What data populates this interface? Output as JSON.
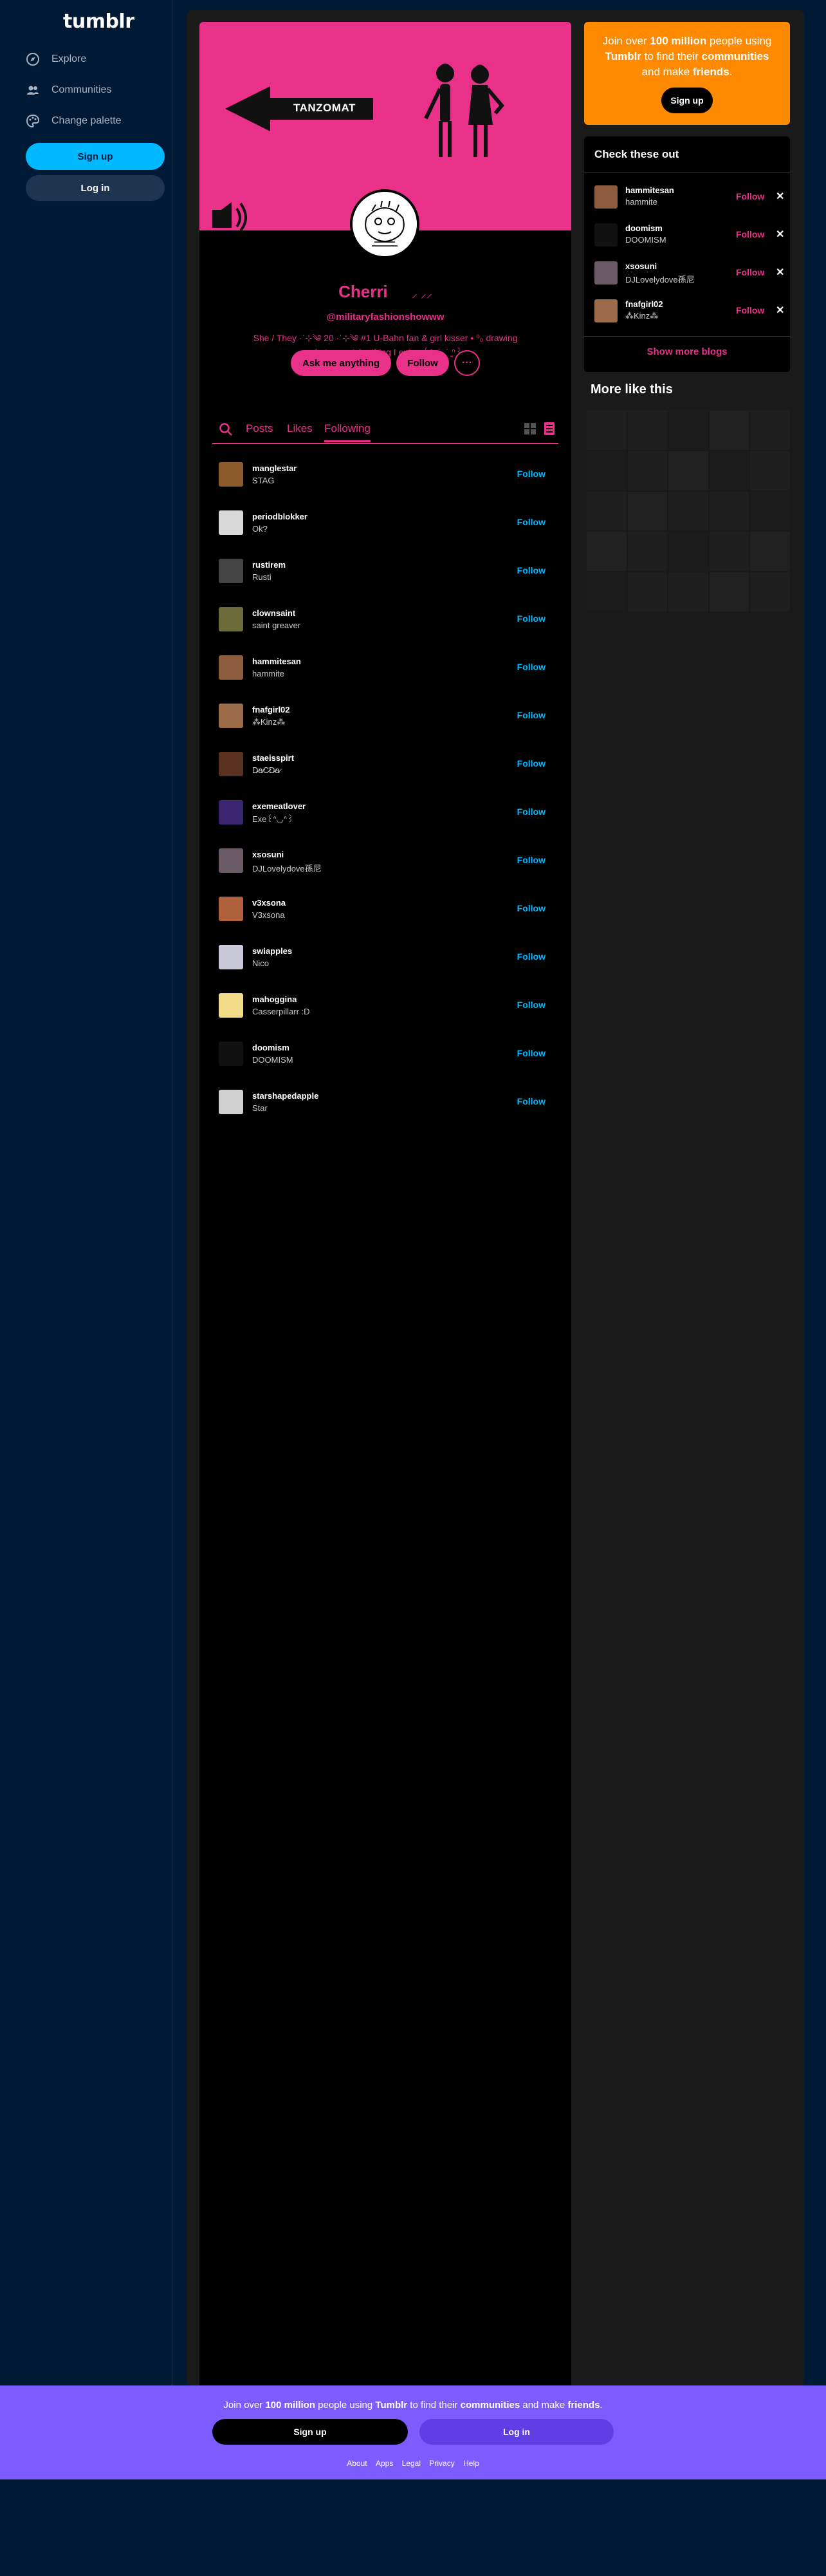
{
  "app": {
    "logo": "tumblr"
  },
  "leftnav": {
    "items": [
      {
        "label": "Explore",
        "icon": "compass-icon"
      },
      {
        "label": "Communities",
        "icon": "people-icon"
      },
      {
        "label": "Change palette",
        "icon": "palette-icon"
      }
    ],
    "signup_label": "Sign up",
    "login_label": "Log in"
  },
  "header": {
    "banner_text": "TANZOMAT",
    "accent": "#e9318a"
  },
  "blog": {
    "title": "Cherri",
    "title_deco": "⸝ ⸝⸝",
    "handle": "@militaryfashionshowww",
    "description": "She / They ·ˈ⊹༄ 20 ·ˈ⊹༄ #1 U-Bahn fan & girl kisser • ⁰₀ drawing whatever niche thing I enjoy ꒰ᐢ ̳ ˙ ̫ ˙ ̳ᐢ꒱",
    "ask_label": "Ask me anything",
    "follow_label": "Follow",
    "more_label": "···"
  },
  "tabs": [
    {
      "label": "Posts",
      "active": false
    },
    {
      "label": "Likes",
      "active": false
    },
    {
      "label": "Following",
      "active": true
    }
  ],
  "following": [
    {
      "name": "manglestar",
      "title": "STAG",
      "follow": "Follow",
      "color": "#8a5a2b"
    },
    {
      "name": "periodblokker",
      "title": "Ok?",
      "follow": "Follow",
      "color": "#d9d9d9"
    },
    {
      "name": "rustirem",
      "title": "Rusti",
      "follow": "Follow",
      "color": "#444444"
    },
    {
      "name": "clownsaint",
      "title": "saint greaver",
      "follow": "Follow",
      "color": "#6b6b3a"
    },
    {
      "name": "hammitesan",
      "title": "hammite",
      "follow": "Follow",
      "color": "#8c5a3c"
    },
    {
      "name": "fnafgirl02",
      "title": "⁂Kinz⁂",
      "follow": "Follow",
      "color": "#9c6b4a"
    },
    {
      "name": "staeisspirt",
      "title": "D̷a̷C̷D̷a̷",
      "follow": "Follow",
      "color": "#5a3020"
    },
    {
      "name": "exemeatlover",
      "title": "Exe꒰ᐢ◡ᐢ꒱",
      "follow": "Follow",
      "color": "#3a2470"
    },
    {
      "name": "xsosuni",
      "title": "DJLovelydove孫尼",
      "follow": "Follow",
      "color": "#6a5a66"
    },
    {
      "name": "v3xsona",
      "title": "V3xsona",
      "follow": "Follow",
      "color": "#b0603a"
    },
    {
      "name": "swiapples",
      "title": "Nico",
      "follow": "Follow",
      "color": "#c8c8d8"
    },
    {
      "name": "mahoggina",
      "title": "Casserpillarr :D",
      "follow": "Follow",
      "color": "#f2dc8a"
    },
    {
      "name": "doomism",
      "title": "DOOMISM",
      "follow": "Follow",
      "color": "#111111"
    },
    {
      "name": "starshapedapple",
      "title": "Star",
      "follow": "Follow",
      "color": "#d0d0d0"
    }
  ],
  "promo": {
    "text_parts": [
      "Join over ",
      "100 million",
      " people using ",
      "Tumblr",
      " to find their ",
      "communities",
      " and make ",
      "friends",
      "."
    ],
    "signup_label": "Sign up",
    "color": "#ff8a00"
  },
  "check": {
    "title": "Check these out",
    "items": [
      {
        "name": "hammitesan",
        "title": "hammite",
        "follow": "Follow",
        "color": "#8c5a3c"
      },
      {
        "name": "doomism",
        "title": "DOOMISM",
        "follow": "Follow",
        "color": "#111111"
      },
      {
        "name": "xsosuni",
        "title": "DJLovelydove孫尼",
        "follow": "Follow",
        "color": "#6a5a66"
      },
      {
        "name": "fnafgirl02",
        "title": "⁂Kinz⁂",
        "follow": "Follow",
        "color": "#9c6b4a"
      }
    ],
    "show_more": "Show more blogs"
  },
  "more_like": "More like this",
  "banner": {
    "text_parts": [
      "Join over ",
      "100 million",
      " people using ",
      "Tumblr",
      " to find their ",
      "communities",
      " and make ",
      "friends",
      "."
    ],
    "signup_label": "Sign up",
    "login_label": "Log in",
    "links": [
      "About",
      "Apps",
      "Legal",
      "Privacy",
      "Help"
    ],
    "color": "#7c5cff"
  }
}
